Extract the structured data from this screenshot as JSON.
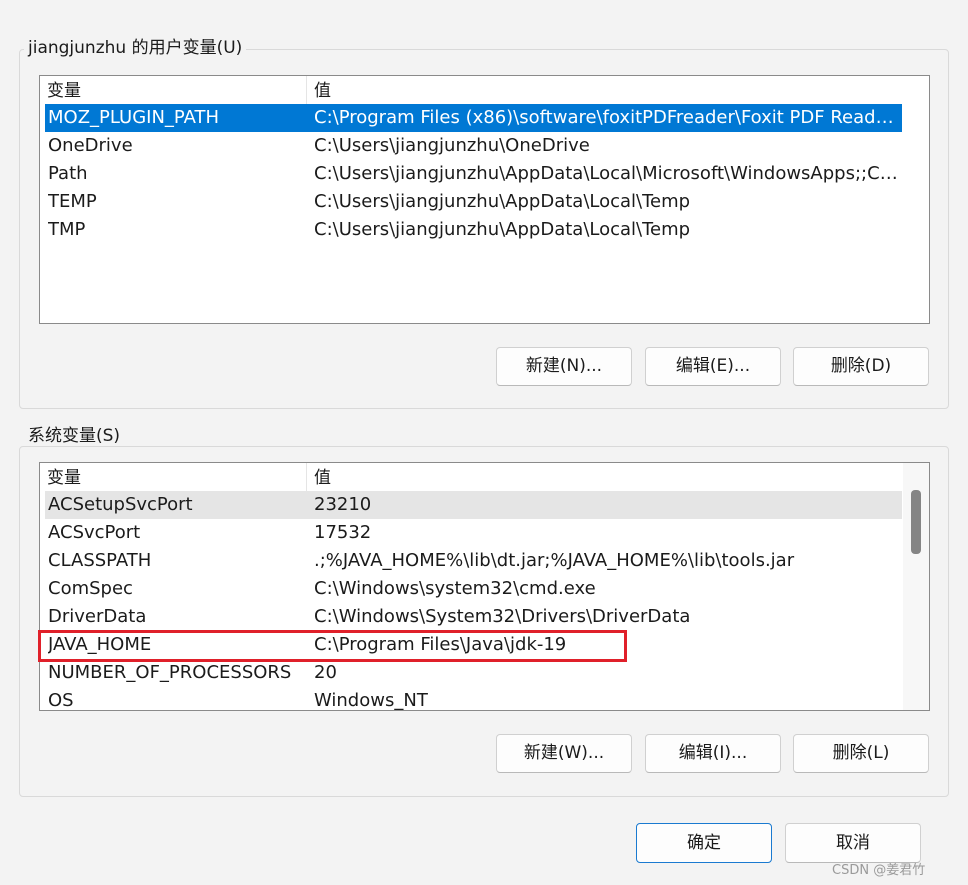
{
  "user_group": {
    "title": "jiangjunzhu 的用户变量(U)",
    "col_variable": "变量",
    "col_value": "值",
    "rows": [
      {
        "name": "MOZ_PLUGIN_PATH",
        "value": "C:\\Program Files (x86)\\software\\foxitPDFreader\\Foxit PDF Reader\\..."
      },
      {
        "name": "OneDrive",
        "value": "C:\\Users\\jiangjunzhu\\OneDrive"
      },
      {
        "name": "Path",
        "value": "C:\\Users\\jiangjunzhu\\AppData\\Local\\Microsoft\\WindowsApps;;C:\\..."
      },
      {
        "name": "TEMP",
        "value": "C:\\Users\\jiangjunzhu\\AppData\\Local\\Temp"
      },
      {
        "name": "TMP",
        "value": "C:\\Users\\jiangjunzhu\\AppData\\Local\\Temp"
      }
    ],
    "selected_index": 0,
    "buttons": {
      "new": "新建(N)...",
      "edit": "编辑(E)...",
      "delete": "删除(D)"
    }
  },
  "system_group": {
    "title": "系统变量(S)",
    "col_variable": "变量",
    "col_value": "值",
    "rows": [
      {
        "name": "ACSetupSvcPort",
        "value": "23210"
      },
      {
        "name": "ACSvcPort",
        "value": "17532"
      },
      {
        "name": "CLASSPATH",
        "value": ".;%JAVA_HOME%\\lib\\dt.jar;%JAVA_HOME%\\lib\\tools.jar"
      },
      {
        "name": "ComSpec",
        "value": "C:\\Windows\\system32\\cmd.exe"
      },
      {
        "name": "DriverData",
        "value": "C:\\Windows\\System32\\Drivers\\DriverData"
      },
      {
        "name": "JAVA_HOME",
        "value": "C:\\Program Files\\Java\\jdk-19"
      },
      {
        "name": "NUMBER_OF_PROCESSORS",
        "value": "20"
      },
      {
        "name": "OS",
        "value": "Windows_NT"
      }
    ],
    "hover_index": 0,
    "highlighted_index": 5,
    "highlight_color": "#e0202a",
    "buttons": {
      "new": "新建(W)...",
      "edit": "编辑(I)...",
      "delete": "删除(L)"
    }
  },
  "footer": {
    "ok": "确定",
    "cancel": "取消"
  },
  "watermark": "CSDN @姜君竹",
  "colors": {
    "selection": "#0078d4",
    "primary_border": "#1a7ad0"
  }
}
